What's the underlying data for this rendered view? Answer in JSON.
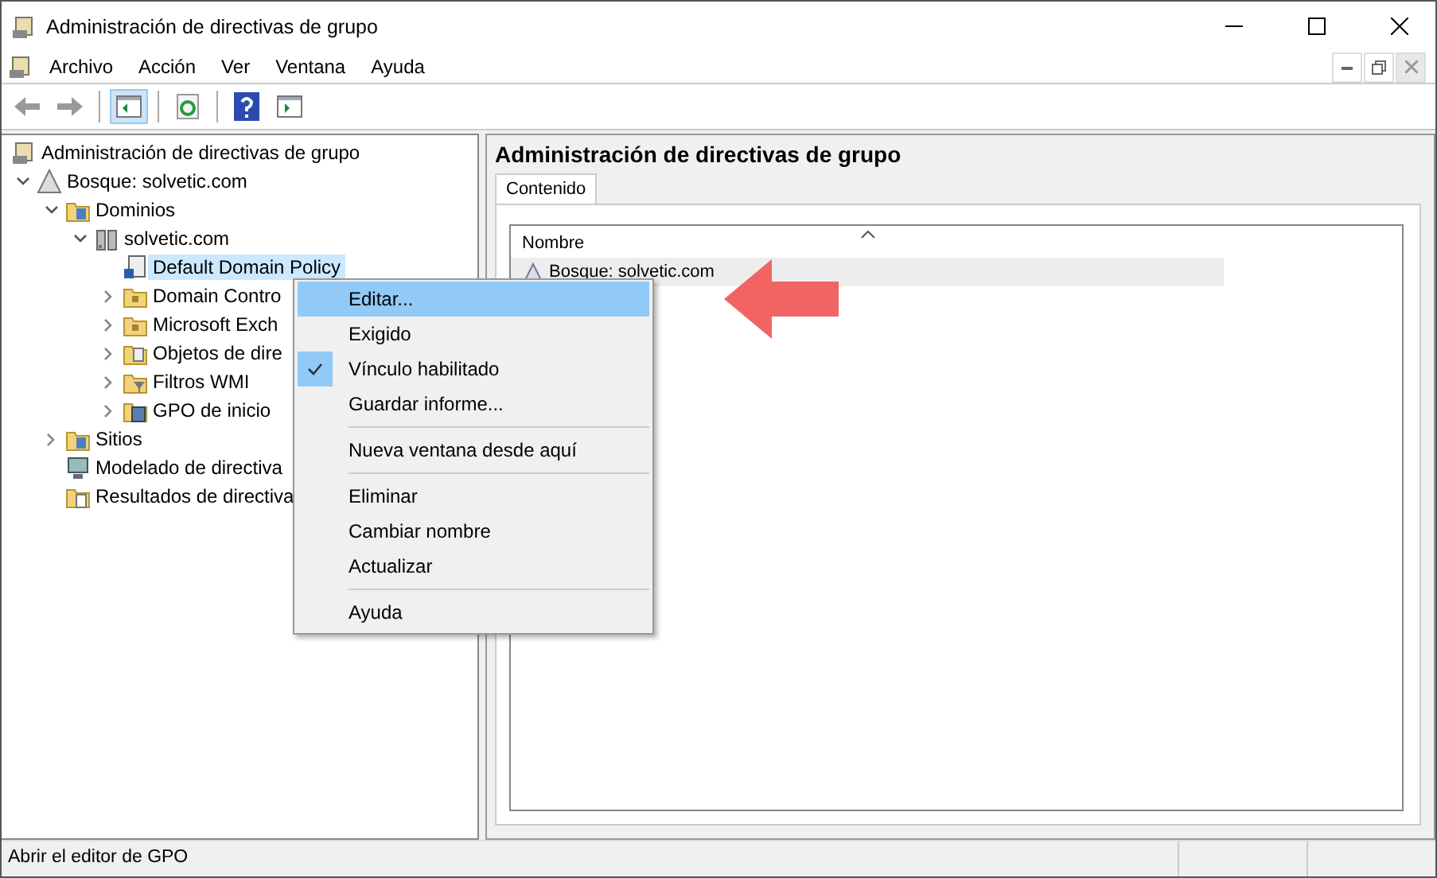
{
  "window": {
    "title": "Administración de directivas de grupo"
  },
  "menu": [
    "Archivo",
    "Acción",
    "Ver",
    "Ventana",
    "Ayuda"
  ],
  "toolbar": [
    {
      "kind": "back",
      "disabled": true,
      "pressed": false
    },
    {
      "kind": "forward",
      "disabled": true,
      "pressed": false
    },
    {
      "kind": "separator"
    },
    {
      "kind": "console-tree",
      "pressed": true
    },
    {
      "kind": "separator"
    },
    {
      "kind": "refresh",
      "pressed": false
    },
    {
      "kind": "separator"
    },
    {
      "kind": "help",
      "pressed": false
    },
    {
      "kind": "action-pane",
      "pressed": false
    }
  ],
  "tree": [
    {
      "kind": "root",
      "label": "Administración de directivas de grupo",
      "selected": false,
      "children": [
        {
          "kind": "forest",
          "label": "Bosque: solvetic.com",
          "expanded": true,
          "selected": false,
          "children": [
            {
              "kind": "container",
              "label": "Dominios",
              "expanded": true,
              "selected": false,
              "children": [
                {
                  "kind": "domain",
                  "label": "solvetic.com",
                  "expanded": true,
                  "selected": false,
                  "children": [
                    {
                      "kind": "policy",
                      "label": "Default Domain Policy",
                      "selected": true
                    },
                    {
                      "kind": "unit",
                      "label": "Domain Contro",
                      "expanded": false,
                      "selected": false
                    },
                    {
                      "kind": "unit",
                      "label": "Microsoft Exch",
                      "expanded": false,
                      "selected": false
                    },
                    {
                      "kind": "policies",
                      "label": "Objetos de dire",
                      "expanded": false,
                      "selected": false
                    },
                    {
                      "kind": "filters",
                      "label": "Filtros WMI",
                      "expanded": false,
                      "selected": false
                    },
                    {
                      "kind": "starters",
                      "label": "GPO de inicio",
                      "expanded": false,
                      "selected": false
                    }
                  ]
                }
              ]
            },
            {
              "kind": "sites",
              "label": "Sitios",
              "expanded": false,
              "selected": false
            },
            {
              "kind": "modeling",
              "label": "Modelado de directiva",
              "selected": false
            },
            {
              "kind": "results",
              "label": "Resultados de directiva",
              "selected": false
            }
          ]
        }
      ]
    }
  ],
  "context_menu": [
    {
      "kind": "item",
      "label": "Editar...",
      "selected": true,
      "checked": false
    },
    {
      "kind": "item",
      "label": "Exigido",
      "selected": false,
      "checked": false
    },
    {
      "kind": "item",
      "label": "Vínculo habilitado",
      "selected": false,
      "checked": true
    },
    {
      "kind": "item",
      "label": "Guardar informe...",
      "selected": false,
      "checked": false
    },
    {
      "kind": "separator"
    },
    {
      "kind": "item",
      "label": "Nueva ventana desde aquí",
      "selected": false,
      "checked": false
    },
    {
      "kind": "separator"
    },
    {
      "kind": "item",
      "label": "Eliminar",
      "selected": false,
      "checked": false
    },
    {
      "kind": "item",
      "label": "Cambiar nombre",
      "selected": false,
      "checked": false
    },
    {
      "kind": "item",
      "label": "Actualizar",
      "selected": false,
      "checked": false
    },
    {
      "kind": "separator"
    },
    {
      "kind": "item",
      "label": "Ayuda",
      "selected": false,
      "checked": false
    }
  ],
  "details": {
    "heading": "Administración de directivas de grupo",
    "tabs": [
      {
        "label": "Contenido",
        "selected": true
      }
    ],
    "columns": [
      "Nombre"
    ],
    "rows": [
      {
        "name": "Bosque: solvetic.com",
        "selected": true
      }
    ]
  },
  "status_bar": {
    "text": "Abrir el editor de GPO"
  }
}
